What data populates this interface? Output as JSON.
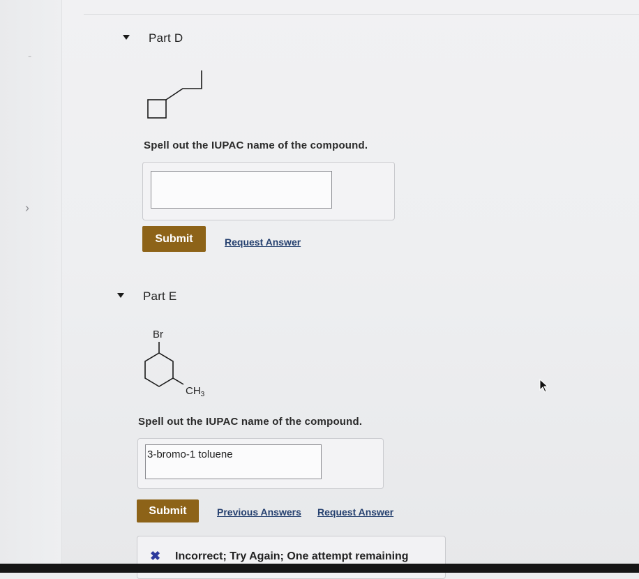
{
  "partD": {
    "title": "Part D",
    "prompt": "Spell out the IUPAC name of the compound.",
    "answer_value": "",
    "submit_label": "Submit",
    "request_answer_label": "Request Answer"
  },
  "partE": {
    "title": "Part E",
    "prompt": "Spell out the IUPAC name of the compound.",
    "answer_value": "3-bromo-1 toluene",
    "submit_label": "Submit",
    "previous_answers_label": "Previous Answers",
    "request_answer_label": "Request Answer",
    "structure_labels": {
      "bromine": "Br",
      "methyl": "CH",
      "methyl_subscript": "3"
    },
    "feedback": "Incorrect; Try Again; One attempt remaining"
  },
  "colors": {
    "submit_button": "#8d6318",
    "link": "#25406f",
    "incorrect_icon": "#2d3a9c"
  }
}
